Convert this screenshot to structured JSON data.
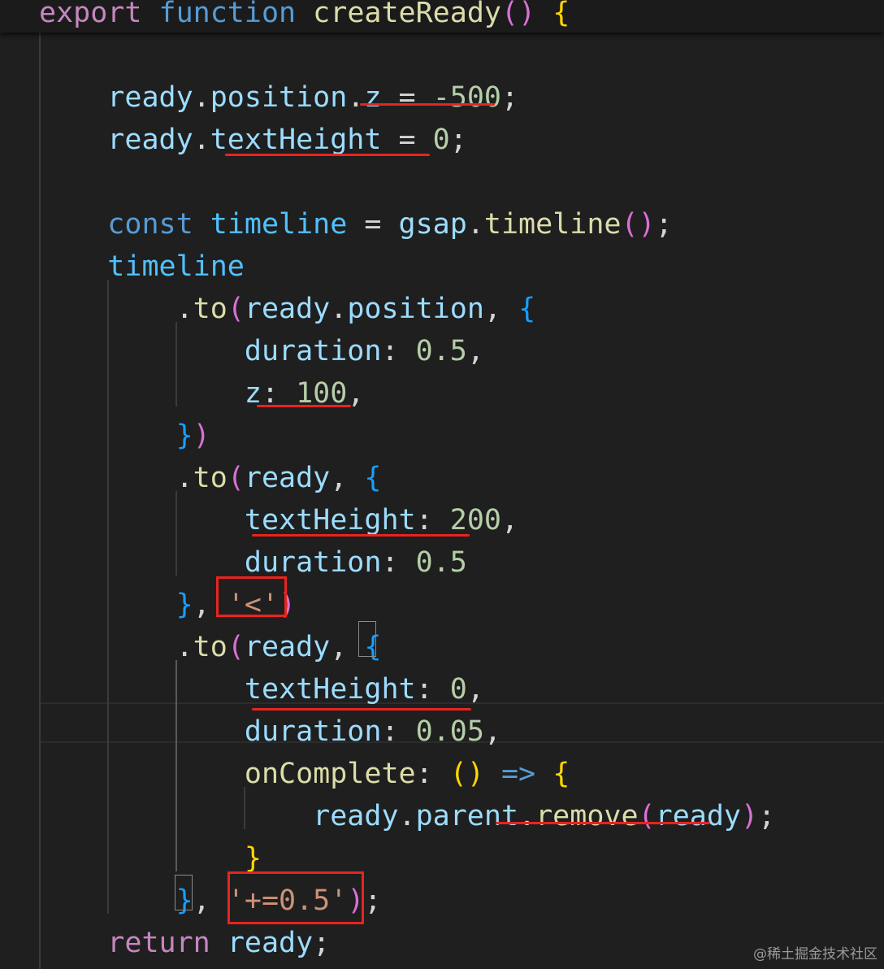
{
  "editor": {
    "language": "javascript",
    "theme_background": "#1f1f1f",
    "annotation_color": "#e8241f",
    "lines": [
      [
        {
          "t": "export",
          "c": "kw"
        },
        {
          "t": " "
        },
        {
          "t": "function",
          "c": "st"
        },
        {
          "t": " "
        },
        {
          "t": "createReady",
          "c": "fn"
        },
        {
          "t": "()",
          "c": "b2"
        },
        {
          "t": " "
        },
        {
          "t": "{",
          "c": "b1"
        }
      ],
      [],
      [
        {
          "t": "    "
        },
        {
          "t": "ready",
          "c": "var"
        },
        {
          "t": ".",
          "c": "p"
        },
        {
          "t": "position",
          "c": "var"
        },
        {
          "t": ".",
          "c": "p"
        },
        {
          "t": "z",
          "c": "var"
        },
        {
          "t": " = ",
          "c": "p"
        },
        {
          "t": "-500",
          "c": "num"
        },
        {
          "t": ";",
          "c": "p"
        }
      ],
      [
        {
          "t": "    "
        },
        {
          "t": "ready",
          "c": "var"
        },
        {
          "t": ".",
          "c": "p"
        },
        {
          "t": "textHeight",
          "c": "var"
        },
        {
          "t": " = ",
          "c": "p"
        },
        {
          "t": "0",
          "c": "num"
        },
        {
          "t": ";",
          "c": "p"
        }
      ],
      [],
      [
        {
          "t": "    "
        },
        {
          "t": "const",
          "c": "st"
        },
        {
          "t": " "
        },
        {
          "t": "timeline",
          "c": "prop"
        },
        {
          "t": " = ",
          "c": "p"
        },
        {
          "t": "gsap",
          "c": "var"
        },
        {
          "t": ".",
          "c": "p"
        },
        {
          "t": "timeline",
          "c": "fn"
        },
        {
          "t": "()",
          "c": "b2"
        },
        {
          "t": ";",
          "c": "p"
        }
      ],
      [
        {
          "t": "    "
        },
        {
          "t": "timeline",
          "c": "prop"
        }
      ],
      [
        {
          "t": "        "
        },
        {
          "t": ".",
          "c": "p"
        },
        {
          "t": "to",
          "c": "fn"
        },
        {
          "t": "(",
          "c": "b2"
        },
        {
          "t": "ready",
          "c": "var"
        },
        {
          "t": ".",
          "c": "p"
        },
        {
          "t": "position",
          "c": "var"
        },
        {
          "t": ", ",
          "c": "p"
        },
        {
          "t": "{",
          "c": "b3"
        }
      ],
      [
        {
          "t": "            "
        },
        {
          "t": "duration",
          "c": "var"
        },
        {
          "t": ": ",
          "c": "p"
        },
        {
          "t": "0.5",
          "c": "num"
        },
        {
          "t": ",",
          "c": "p"
        }
      ],
      [
        {
          "t": "            "
        },
        {
          "t": "z",
          "c": "var"
        },
        {
          "t": ": ",
          "c": "p"
        },
        {
          "t": "100",
          "c": "num"
        },
        {
          "t": ",",
          "c": "p"
        }
      ],
      [
        {
          "t": "        "
        },
        {
          "t": "}",
          "c": "b3"
        },
        {
          "t": ")",
          "c": "b2"
        }
      ],
      [
        {
          "t": "        "
        },
        {
          "t": ".",
          "c": "p"
        },
        {
          "t": "to",
          "c": "fn"
        },
        {
          "t": "(",
          "c": "b2"
        },
        {
          "t": "ready",
          "c": "var"
        },
        {
          "t": ", ",
          "c": "p"
        },
        {
          "t": "{",
          "c": "b3"
        }
      ],
      [
        {
          "t": "            "
        },
        {
          "t": "textHeight",
          "c": "var"
        },
        {
          "t": ": ",
          "c": "p"
        },
        {
          "t": "200",
          "c": "num"
        },
        {
          "t": ",",
          "c": "p"
        }
      ],
      [
        {
          "t": "            "
        },
        {
          "t": "duration",
          "c": "var"
        },
        {
          "t": ": ",
          "c": "p"
        },
        {
          "t": "0.5",
          "c": "num"
        }
      ],
      [
        {
          "t": "        "
        },
        {
          "t": "}",
          "c": "b3"
        },
        {
          "t": ", ",
          "c": "p"
        },
        {
          "t": "'<'",
          "c": "str"
        },
        {
          "t": ")",
          "c": "b2"
        }
      ],
      [
        {
          "t": "        "
        },
        {
          "t": ".",
          "c": "p"
        },
        {
          "t": "to",
          "c": "fn"
        },
        {
          "t": "(",
          "c": "b2"
        },
        {
          "t": "ready",
          "c": "var"
        },
        {
          "t": ", ",
          "c": "p"
        },
        {
          "t": "{",
          "c": "b3"
        }
      ],
      [
        {
          "t": "            "
        },
        {
          "t": "textHeight",
          "c": "var"
        },
        {
          "t": ": ",
          "c": "p"
        },
        {
          "t": "0",
          "c": "num"
        },
        {
          "t": ",",
          "c": "p"
        }
      ],
      [
        {
          "t": "            "
        },
        {
          "t": "duration",
          "c": "var"
        },
        {
          "t": ": ",
          "c": "p"
        },
        {
          "t": "0.05",
          "c": "num"
        },
        {
          "t": ",",
          "c": "p"
        }
      ],
      [
        {
          "t": "            "
        },
        {
          "t": "onComplete",
          "c": "fn"
        },
        {
          "t": ": ",
          "c": "p"
        },
        {
          "t": "()",
          "c": "b1"
        },
        {
          "t": " "
        },
        {
          "t": "=>",
          "c": "st"
        },
        {
          "t": " "
        },
        {
          "t": "{",
          "c": "b1"
        }
      ],
      [
        {
          "t": "                "
        },
        {
          "t": "ready",
          "c": "var"
        },
        {
          "t": ".",
          "c": "p"
        },
        {
          "t": "parent",
          "c": "var"
        },
        {
          "t": ".",
          "c": "p"
        },
        {
          "t": "remove",
          "c": "fn"
        },
        {
          "t": "(",
          "c": "b2"
        },
        {
          "t": "ready",
          "c": "var"
        },
        {
          "t": ")",
          "c": "b2"
        },
        {
          "t": ";",
          "c": "p"
        }
      ],
      [
        {
          "t": "            "
        },
        {
          "t": "}",
          "c": "b1"
        }
      ],
      [
        {
          "t": "        "
        },
        {
          "t": "}",
          "c": "b3"
        },
        {
          "t": ", ",
          "c": "p"
        },
        {
          "t": "'+=0.5'",
          "c": "str"
        },
        {
          "t": ")",
          "c": "b2"
        },
        {
          "t": ";",
          "c": "p"
        }
      ],
      [
        {
          "t": "    "
        },
        {
          "t": "return",
          "c": "kw"
        },
        {
          "t": " "
        },
        {
          "t": "ready",
          "c": "var"
        },
        {
          "t": ";",
          "c": "p"
        }
      ],
      [
        {
          "t": "}",
          "c": "b1"
        }
      ]
    ]
  },
  "watermark": "@稀土掘金技术社区"
}
